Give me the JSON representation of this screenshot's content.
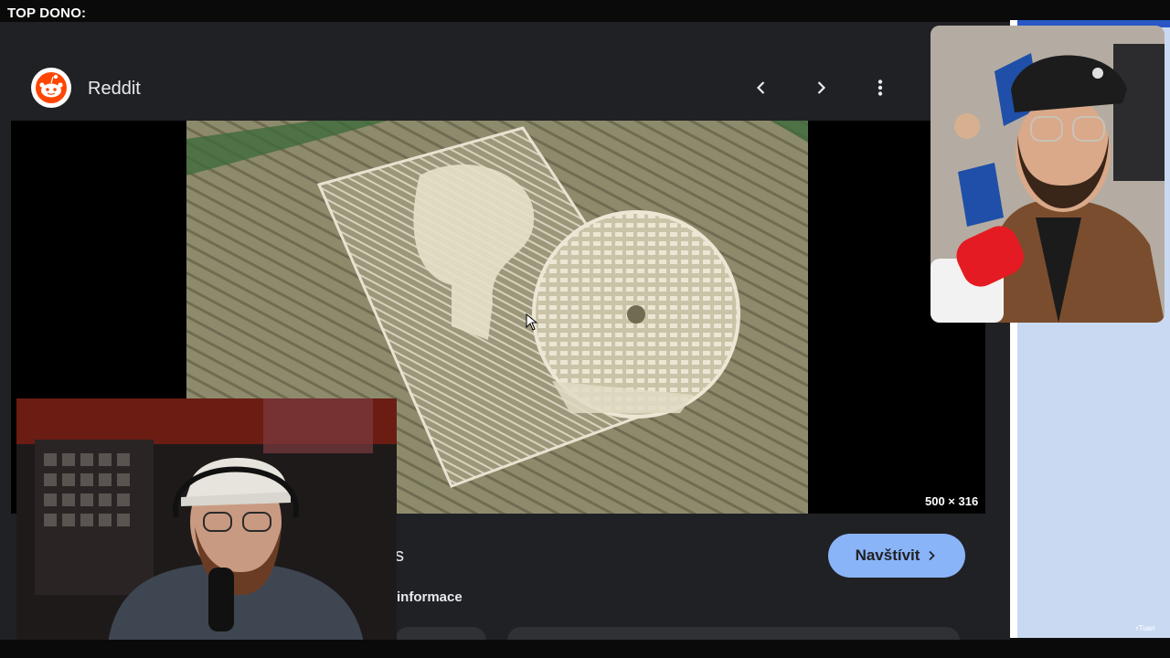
{
  "overlay": {
    "top_dono_label": "TOP DONO:"
  },
  "result": {
    "site_name": "Reddit",
    "image_dimensions": "500 × 316",
    "title_fragment": "s",
    "info_fragment": "informace",
    "visit_button_label": "Navštívit"
  },
  "watermark": "rTuan",
  "icons": {
    "logo": "reddit-logo",
    "prev": "chevron-left-icon",
    "next": "chevron-right-icon",
    "more": "more-vert-icon",
    "visit": "chevron-right-icon"
  },
  "colors": {
    "panel_bg": "#202124",
    "accent_button": "#8ab4f8",
    "reddit_orange": "#ff4500"
  }
}
